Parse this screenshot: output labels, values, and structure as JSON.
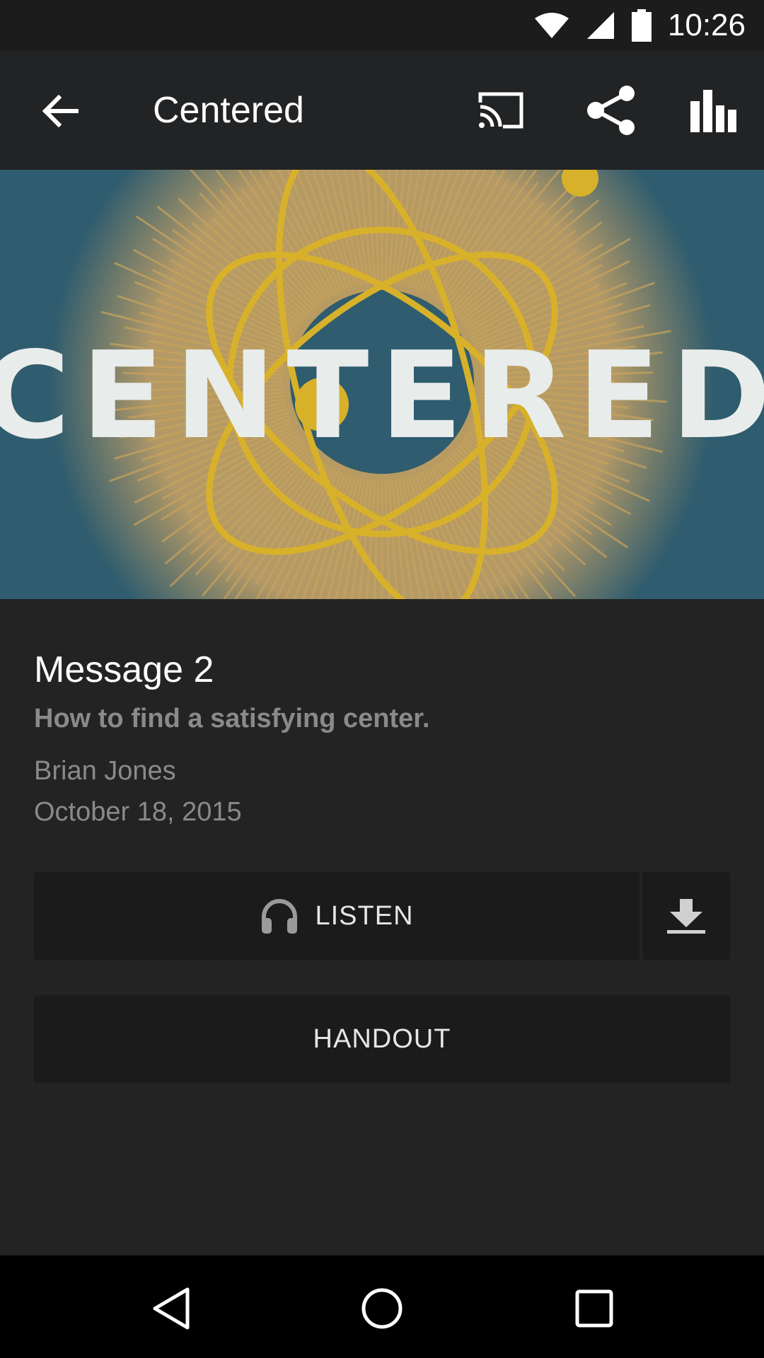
{
  "status_bar": {
    "time": "10:26",
    "icons": [
      "wifi-icon",
      "cell-signal-icon",
      "battery-icon"
    ]
  },
  "app_bar": {
    "title": "Centered",
    "back_icon": "arrow-back-icon",
    "actions": [
      "cast-icon",
      "share-icon",
      "bar-chart-icon"
    ]
  },
  "hero": {
    "artwork_text": "CENTERED",
    "colors": {
      "background": "#2f5c6e",
      "burst": "#c9a35c",
      "orbit": "#d8b12a",
      "text": "#e8ecea"
    }
  },
  "message": {
    "title": "Message 2",
    "subtitle": "How to find a satisfying center.",
    "speaker": "Brian Jones",
    "date": "October 18, 2015"
  },
  "buttons": {
    "listen_label": "LISTEN",
    "listen_icon": "headphones-icon",
    "download_icon": "download-icon",
    "handout_label": "HANDOUT"
  },
  "nav_bar": {
    "icons": [
      "back-triangle-icon",
      "home-circle-icon",
      "recents-square-icon"
    ]
  },
  "colors": {
    "app_bar": "#222324",
    "content_bg": "#232323",
    "button_bg": "#1b1b1b",
    "secondary_text": "#8a8a8a"
  }
}
